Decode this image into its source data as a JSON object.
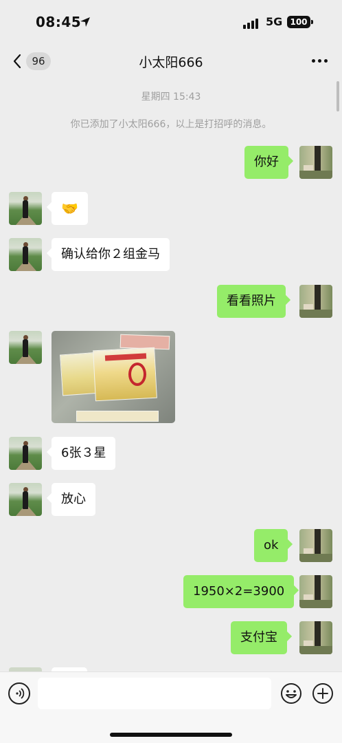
{
  "status_bar": {
    "time": "08:45",
    "network": "5G",
    "battery": "100"
  },
  "nav": {
    "unread_count": "96",
    "title": "小太阳666"
  },
  "system": {
    "timestamp": "星期四 15:43",
    "added_note": "你已添加了小太阳666，以上是打招呼的消息。"
  },
  "messages": [
    {
      "side": "out",
      "text": "你好"
    },
    {
      "side": "in",
      "text": "🤝"
    },
    {
      "side": "in",
      "text": "确认给你２组金马"
    },
    {
      "side": "out",
      "text": "看看照片"
    },
    {
      "side": "in",
      "type": "image"
    },
    {
      "side": "in",
      "text": "6张３星"
    },
    {
      "side": "in",
      "text": "放心"
    },
    {
      "side": "out",
      "text": "ok"
    },
    {
      "side": "out",
      "text": "1950×2=3900"
    },
    {
      "side": "out",
      "text": "支付宝"
    }
  ],
  "input": {
    "placeholder": ""
  },
  "colors": {
    "background": "#ededed",
    "outgoing_bubble": "#95ec69",
    "incoming_bubble": "#ffffff"
  },
  "icons": [
    "location-arrow-icon",
    "signal-icon",
    "battery-icon",
    "back-chevron-icon",
    "more-dots-icon",
    "voice-icon",
    "emoji-icon",
    "plus-icon"
  ]
}
